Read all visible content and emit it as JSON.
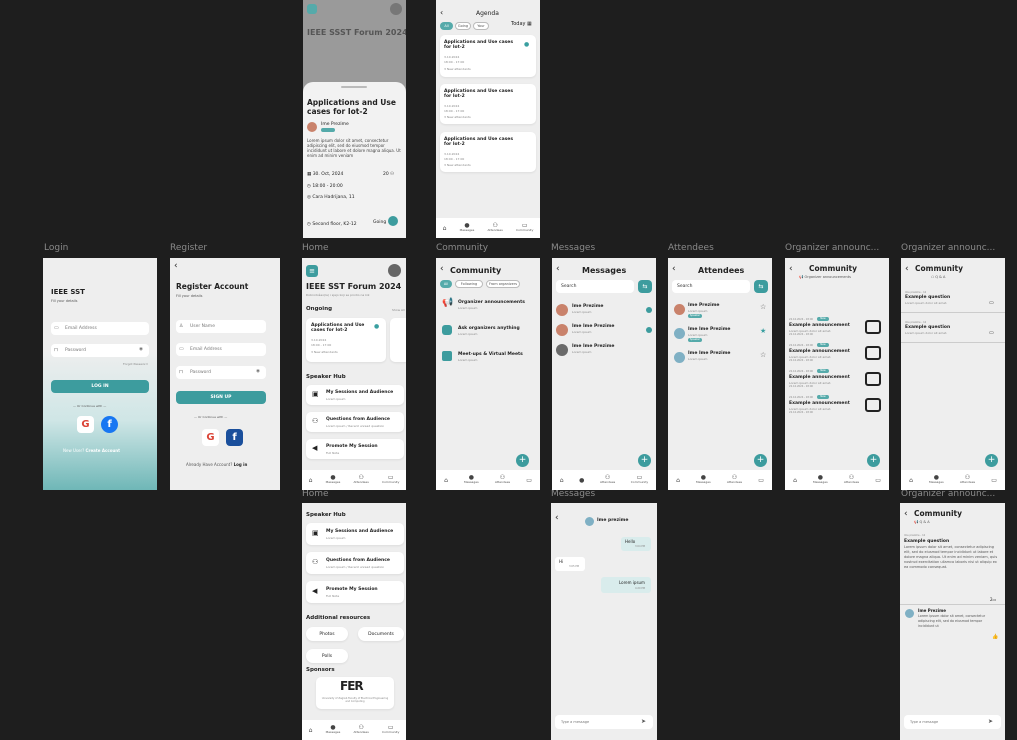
{
  "labels": {
    "login": "Login",
    "register": "Register",
    "home": "Home",
    "community": "Community",
    "messages": "Messages",
    "attendees": "Attendees",
    "org1": "Organizer announc...",
    "org2": "Organizer announc...",
    "home2": "Home",
    "messages2": "Messages",
    "org3": "Organizer announc..."
  },
  "top": {
    "detail": {
      "title_bg": "IEEE SSST Forum 2024",
      "title": "Applications and Use cases for Iot-2",
      "speaker": "Ime Prezime",
      "body": "Lorem ipsum dolor sit amet, consectetur adipiscing elit, sed do eiusmod tempor incididunt ut labore et dolore magna aliqua. Ut enim ad minim veniam",
      "date": "30. Oct, 2024",
      "count": "20",
      "time": "18:00 - 20:00",
      "location": "Cara Hadrijana, 11",
      "room": "Second floor, K2-12",
      "going": "Going"
    },
    "agenda": {
      "title": "Agenda",
      "today": "Today",
      "tabs": [
        "All",
        "Going",
        "Your"
      ],
      "items": [
        {
          "title": "Applications and Use cases for Iot-2",
          "date": "3.10.2024",
          "time": "18:00 - 17:00",
          "att": "3 New attendants"
        },
        {
          "title": "Applications and Use cases for Iot-2",
          "date": "3.10.2024",
          "time": "18:00 - 17:00",
          "att": "3 New attendants"
        },
        {
          "title": "Applications and Use cases for Iot-2",
          "date": "3.10.2024",
          "time": "18:00 - 17:00",
          "att": "3 New attendants"
        }
      ]
    }
  },
  "login": {
    "title": "IEEE SST",
    "subtitle": "Fill your details",
    "email": "Email Address",
    "password": "Password",
    "forgot": "Forgot Password",
    "button": "LOG IN",
    "continue": "Or Continue with",
    "new_user": "New User?",
    "create": "Create Account"
  },
  "register": {
    "title": "Register Account",
    "subtitle": "Fill your details",
    "user": "User Name",
    "email": "Email Address",
    "password": "Password",
    "button": "SIGN UP",
    "continue": "Or Continue with",
    "already": "Already Have Account?",
    "login": "Log in"
  },
  "home": {
    "title": "IEEE SST Forum 2024",
    "subtitle": "Dobrodošao(la) i sjajo koji se prodio na kik",
    "ongoing": "Ongoing",
    "show_all": "Show All",
    "card_title": "Applications and Use cases for Iot-2",
    "card_date": "3.10.2024",
    "card_time": "18:00 - 17:00",
    "card_att": "3 New attendants",
    "speaker_hub": "Speaker Hub",
    "hub": [
      {
        "t": "My Sessions and Audience",
        "s": "Lorem ipsum"
      },
      {
        "t": "Questions from Audience",
        "s": "Lorem ipsum / Recent unread question"
      },
      {
        "t": "Promote My Session",
        "s": "Full Note"
      }
    ]
  },
  "nav": {
    "home": "Home",
    "messages": "Messages",
    "attendees": "Attendees",
    "community": "Community"
  },
  "community": {
    "title": "Community",
    "tabs": [
      "All",
      "Following",
      "From organizers"
    ],
    "items": [
      {
        "t": "Organizer announcements",
        "s": "Lorem ipsum"
      },
      {
        "t": "Ask organizers anything",
        "s": "Lorem ipsum"
      },
      {
        "t": "Meet-ups & Virtual Meets",
        "s": "Lorem ipsum"
      }
    ]
  },
  "messages": {
    "title": "Messages",
    "search": "Search",
    "items": [
      {
        "n": "Ime Prezime",
        "s": "Lorem ipsum"
      },
      {
        "n": "Ime Ime Prezime",
        "s": "Lorem ipsum"
      },
      {
        "n": "Ime Ime Prezime",
        "s": "Lorem ipsum"
      }
    ]
  },
  "attendees": {
    "title": "Attendees",
    "search": "Search",
    "items": [
      {
        "n": "Ime Prezime",
        "s": "Lorem ipsum",
        "tag": "Speaker"
      },
      {
        "n": "Ime Ime Prezime",
        "s": "Lorem ipsum",
        "tag": "Speaker"
      },
      {
        "n": "Ime Ime Prezime",
        "s": "Lorem ipsum"
      }
    ]
  },
  "org": {
    "title": "Community",
    "sub": "Organizer announcements",
    "item_title": "Example announcement",
    "item_body": "Lorem ipsum dolor sit amet.",
    "date": "22.10.2024 - 18:00",
    "tag": "New"
  },
  "qa": {
    "title": "Community",
    "sub": "Q & A",
    "item_title": "Example question",
    "item_body": "Lorem ipsum dolor sit amet.",
    "meta": "Ime prezime - 12"
  },
  "home2": {
    "speaker_hub": "Speaker Hub",
    "hub": [
      {
        "t": "My Sessions and Audience",
        "s": "Lorem ipsum"
      },
      {
        "t": "Questions from Audience",
        "s": "Lorem ipsum / Recent unread question"
      },
      {
        "t": "Promote My Session",
        "s": "Full Note"
      }
    ],
    "resources": "Additional resources",
    "photos": "Photos",
    "documents": "Documents",
    "polls": "Polls",
    "sponsors": "Sponsors",
    "sponsor_logo": "FER",
    "sponsor_text": "University of Zagreb Faculty of Electrical Engineering and Computing"
  },
  "chat": {
    "name": "Ime prezime",
    "m1": "Hello",
    "t1": "3:04 PM",
    "m2": "Hi",
    "t2": "3:05 PM",
    "m3": "Lorem ipsum",
    "t3": "4:20 PM",
    "input": "Type a message"
  },
  "qa2": {
    "title": "Community",
    "sub": "Q & A",
    "meta": "Ime prezime - 12",
    "q_title": "Example question",
    "q_body": "Lorem ipsum dolor sit amet, consectetur adipiscing elit, sed do eiusmod tempor incididunt ut labore et dolore magna aliqua. Ut enim ad minim veniam, quis nostrud exercitation ullamco laboris nisi ut aliquip ex ea commodo consequat.",
    "count": "2",
    "ans_name": "Ime Prezime",
    "ans_body": "Lorem ipsum dolor sit amet, consectetur adipiscing elit, sed do eiusmod tempor incididunt ut",
    "input": "Type a message"
  }
}
